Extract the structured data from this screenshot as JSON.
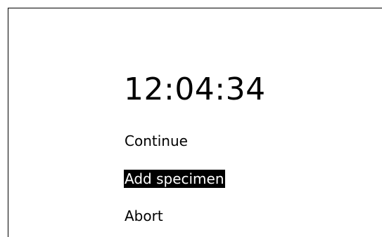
{
  "timer": {
    "value": "12:04:34"
  },
  "menu": {
    "items": [
      {
        "label": "Continue",
        "selected": false
      },
      {
        "label": "Add specimen",
        "selected": true
      },
      {
        "label": "Abort",
        "selected": false
      }
    ]
  },
  "colors": {
    "background": "#ffffff",
    "text": "#000000",
    "highlight_background": "#000000",
    "highlight_text": "#ffffff"
  }
}
